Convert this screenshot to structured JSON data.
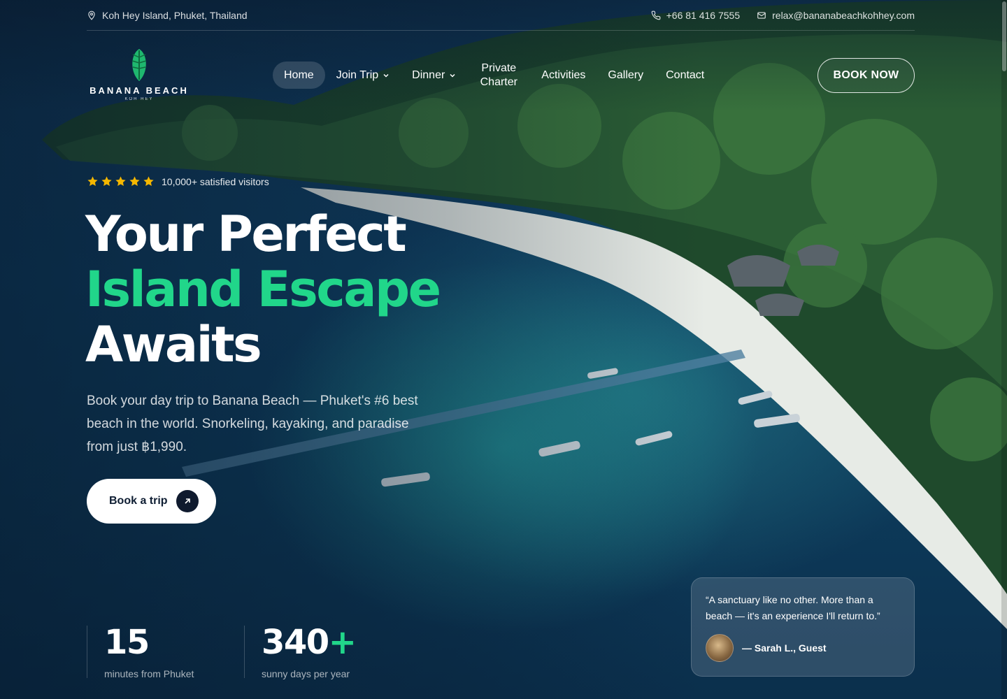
{
  "topbar": {
    "location": "Koh Hey Island, Phuket, Thailand",
    "phone": "+66 81 416 7555",
    "email": "relax@bananabeachkohhey.com"
  },
  "logo": {
    "name": "BANANA BEACH",
    "sub": "KOH HEY"
  },
  "nav": {
    "items": [
      {
        "label": "Home",
        "active": true
      },
      {
        "label": "Join Trip",
        "dropdown": true
      },
      {
        "label": "Dinner",
        "dropdown": true
      },
      {
        "label": "Private Charter"
      },
      {
        "label": "Activities"
      },
      {
        "label": "Gallery"
      },
      {
        "label": "Contact"
      }
    ],
    "cta": "BOOK NOW"
  },
  "hero": {
    "rating_stars": 5,
    "rating_text": "10,000+ satisfied visitors",
    "headline_1": "Your Perfect",
    "headline_2": "Island Escape",
    "headline_3": "Awaits",
    "lead": "Book your day trip to Banana Beach — Phuket's #6 best beach in the world. Snorkeling, kayaking, and paradise from just ฿1,990.",
    "cta": "Book a trip"
  },
  "stats": [
    {
      "value": "15",
      "suffix": "",
      "label": "minutes from Phuket"
    },
    {
      "value": "340",
      "suffix": "+",
      "label": "sunny days per year"
    }
  ],
  "testimonial": {
    "quote": "“A sanctuary like no other. More than a beach — it's an experience I'll return to.”",
    "author": "— Sarah L., Guest"
  },
  "colors": {
    "accent": "#21d68a",
    "star": "#f5b700",
    "ocean": "#0f3f63"
  }
}
